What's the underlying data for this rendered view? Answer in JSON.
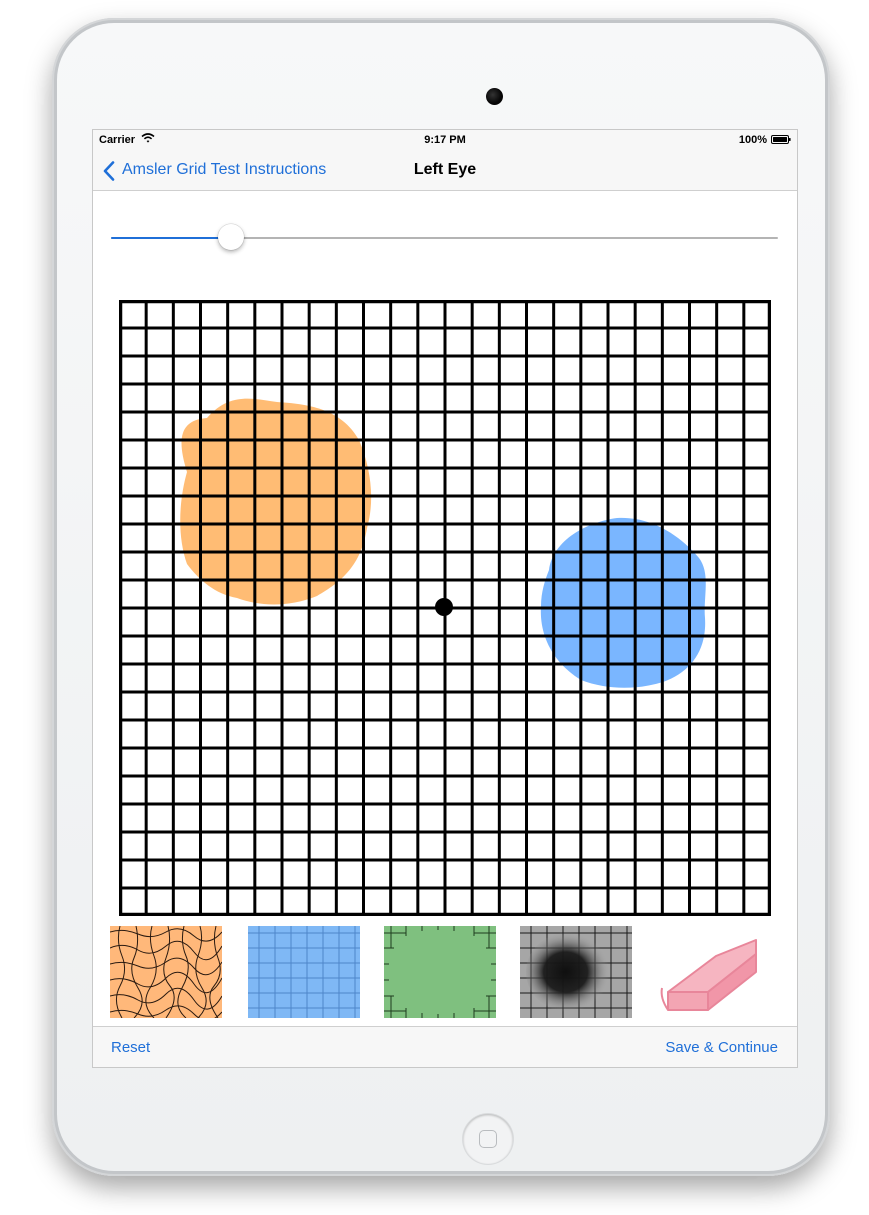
{
  "status_bar": {
    "carrier": "Carrier",
    "time": "9:17 PM",
    "battery": "100%"
  },
  "nav": {
    "back_label": "Amsler Grid Test Instructions",
    "title": "Left Eye"
  },
  "slider": {
    "value": 0.18
  },
  "grid": {
    "columns": 24,
    "rows": 22,
    "line_color": "#000000",
    "markings": [
      {
        "tool": "wavy-lines",
        "color": "#ffb061"
      },
      {
        "tool": "blurry",
        "color": "#5daaff"
      }
    ]
  },
  "tools": [
    {
      "name": "wavy-lines-tool",
      "color": "#ffb87a",
      "icon": "wavy-grid-icon"
    },
    {
      "name": "blurry-tool",
      "color": "#7fb8f5",
      "icon": "blue-grid-icon"
    },
    {
      "name": "missing-area-tool",
      "color": "#7fc07f",
      "icon": "green-faded-grid-icon"
    },
    {
      "name": "dark-spot-tool",
      "color": "#a6a6a6",
      "icon": "dark-spot-icon"
    },
    {
      "name": "eraser-tool",
      "color": "#f3a5b3",
      "icon": "eraser-icon"
    }
  ],
  "toolbar": {
    "reset_label": "Reset",
    "save_label": "Save & Continue"
  },
  "colors": {
    "accent": "#1f6fd8"
  }
}
